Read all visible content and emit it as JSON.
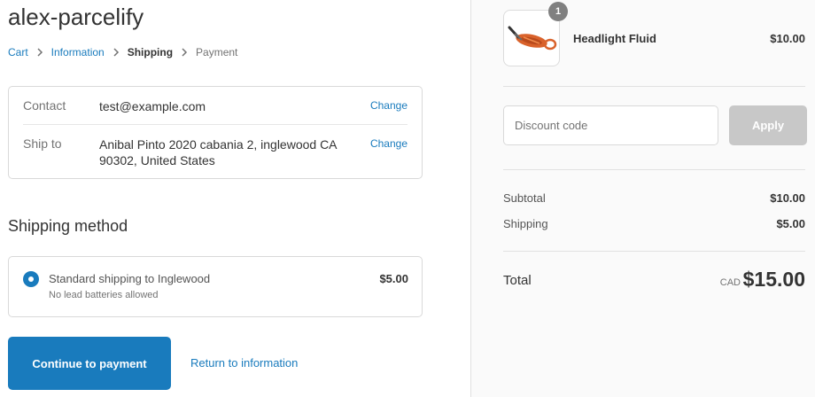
{
  "shop": {
    "name": "alex-parcelify"
  },
  "breadcrumb": {
    "items": [
      {
        "label": "Cart"
      },
      {
        "label": "Information"
      },
      {
        "label": "Shipping"
      },
      {
        "label": "Payment"
      }
    ]
  },
  "review": {
    "contact_label": "Contact",
    "contact_value": "test@example.com",
    "shipto_label": "Ship to",
    "shipto_value": "Anibal Pinto 2020 cabania 2, inglewood CA 90302, United States",
    "change_label": "Change"
  },
  "shipping_method": {
    "title": "Shipping method",
    "rate": {
      "title": "Standard shipping to Inglewood",
      "description": "No lead batteries allowed",
      "price": "$5.00",
      "selected": true
    }
  },
  "actions": {
    "continue_label": "Continue to payment",
    "return_label": "Return to information"
  },
  "order": {
    "product": {
      "name": "Headlight Fluid",
      "price": "$10.00",
      "quantity": "1",
      "image_icon": "headlight-fluid-product-image"
    },
    "discount": {
      "placeholder": "Discount code",
      "apply_label": "Apply"
    },
    "subtotal_label": "Subtotal",
    "subtotal_value": "$10.00",
    "shipping_label": "Shipping",
    "shipping_value": "$5.00",
    "total_label": "Total",
    "currency": "CAD",
    "total_value": "$15.00"
  },
  "colors": {
    "accent": "#197bbd",
    "apply_disabled": "#c8c8c8",
    "sidebar_bg": "#fafafa"
  }
}
